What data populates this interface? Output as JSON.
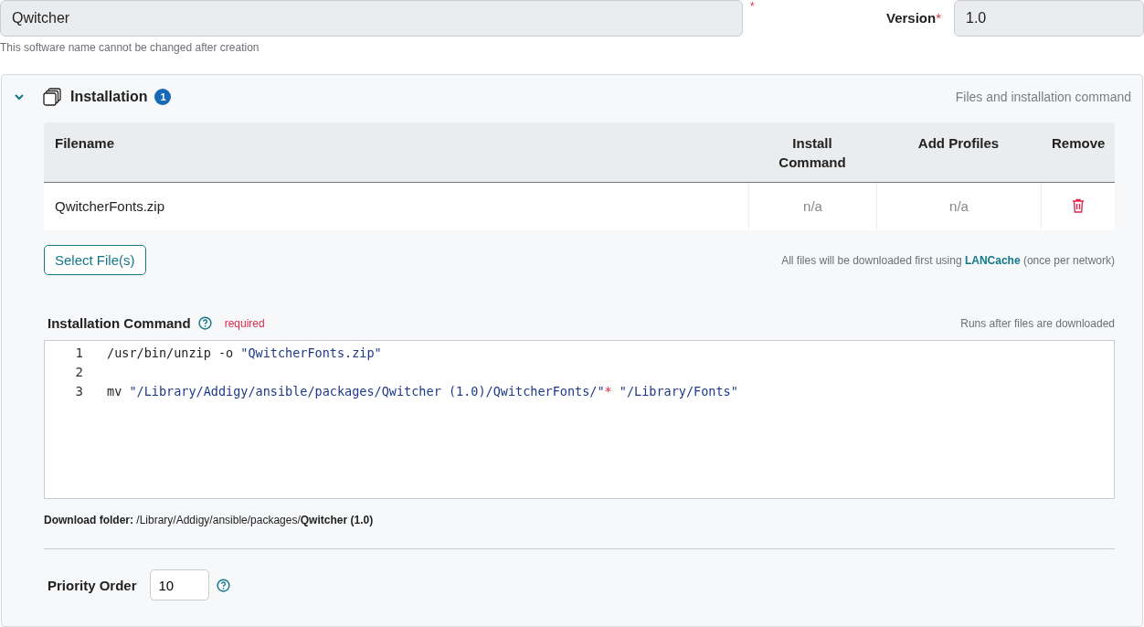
{
  "name_field": {
    "value": "Qwitcher",
    "required_mark": "*",
    "hint": "This software name cannot be changed after creation"
  },
  "version_field": {
    "label": "Version",
    "required_mark": "*",
    "value": "1.0"
  },
  "section": {
    "title": "Installation",
    "badge": "1",
    "expanded": true,
    "subtitle": "Files and installation command",
    "table": {
      "columns": [
        "Filename",
        "Install Command",
        "Add Profiles",
        "Remove"
      ],
      "rows": [
        {
          "filename": "QwitcherFonts.zip",
          "install_command": "n/a",
          "add_profiles": "n/a"
        }
      ]
    },
    "select_button": "Select File(s)",
    "download_note": {
      "before": "All files will be downloaded first using",
      "link": "LANCache",
      "after": "(once per network)"
    },
    "command": {
      "label": "Installation Command",
      "required": "required",
      "note": "Runs after files are downloaded",
      "lines": [
        {
          "number": "1",
          "tokens": [
            {
              "kind": "plain",
              "text": "/usr/bin/unzip -o "
            },
            {
              "kind": "string",
              "text": "\"QwitcherFonts.zip\""
            }
          ]
        },
        {
          "number": "2"
        },
        {
          "number": "3",
          "tokens": [
            {
              "kind": "plain",
              "text": "mv "
            },
            {
              "kind": "string",
              "text": "\"/Library/Addigy/ansible/packages/Qwitcher (1.0)/QwitcherFonts/\""
            },
            {
              "kind": "operator",
              "text": "*"
            },
            {
              "kind": "string",
              "text": " \"/Library/Fonts\""
            }
          ]
        }
      ]
    },
    "download_folder": "**Download folder:** /Library/Addigy/ansible/packages/**Qwitcher (1.0)**",
    "priority": {
      "label": "Priority Order",
      "value": "10"
    }
  }
}
